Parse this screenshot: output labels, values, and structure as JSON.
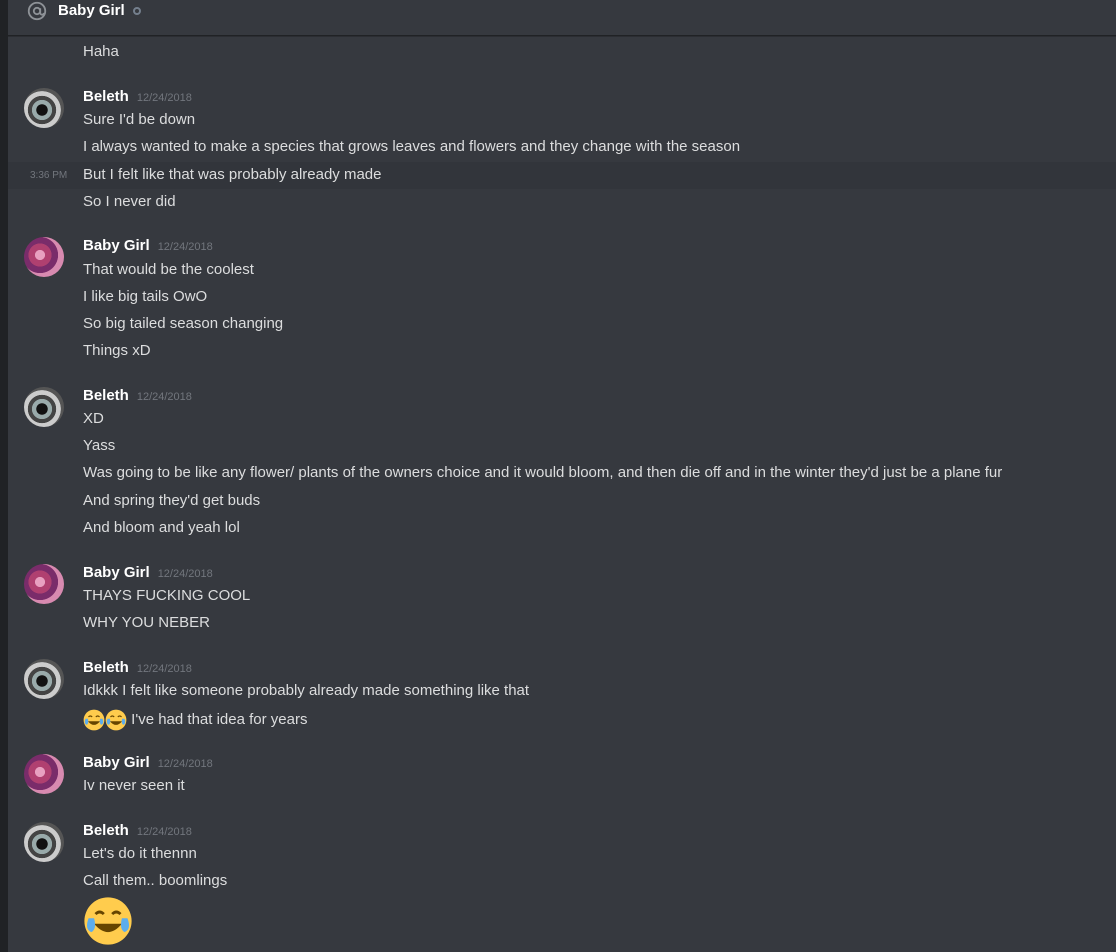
{
  "header": {
    "title": "Baby Girl"
  },
  "hover_time": "3:36 PM",
  "messages": [
    {
      "text": "Haha"
    },
    {
      "author": "Beleth",
      "time": "12/24/2018",
      "lines": [
        "Sure I'd be down",
        "I always wanted to make a species that grows leaves and flowers and they change with the season",
        "But I felt like that was probably already made",
        "So I never did"
      ]
    },
    {
      "author": "Baby Girl",
      "time": "12/24/2018",
      "lines": [
        "That would be the coolest",
        "I like big tails OwO",
        "So big tailed season changing",
        "Things xD"
      ]
    },
    {
      "author": "Beleth",
      "time": "12/24/2018",
      "lines": [
        "XD",
        "Yass",
        "Was going to be like any flower/ plants of the owners choice and it would bloom, and then die off and in the winter they'd just be a plane  fur",
        "And spring they'd get buds",
        "And bloom and yeah lol"
      ]
    },
    {
      "author": "Baby Girl",
      "time": "12/24/2018",
      "lines": [
        "THAYS FUCKING COOL",
        "WHY YOU NEBER"
      ]
    },
    {
      "author": "Beleth",
      "time": "12/24/2018",
      "lines": [
        "Idkkk I felt like someone probably already made something like that",
        "I've had that idea for years"
      ]
    },
    {
      "author": "Baby Girl",
      "time": "12/24/2018",
      "lines": [
        "Iv never seen it"
      ]
    },
    {
      "author": "Beleth",
      "time": "12/24/2018",
      "lines": [
        "Let's do it thennn",
        "Call them.. boomlings"
      ]
    }
  ],
  "icons": {
    "header": "at-icon",
    "status": "status-dot",
    "emoji": "joy-emoji"
  }
}
